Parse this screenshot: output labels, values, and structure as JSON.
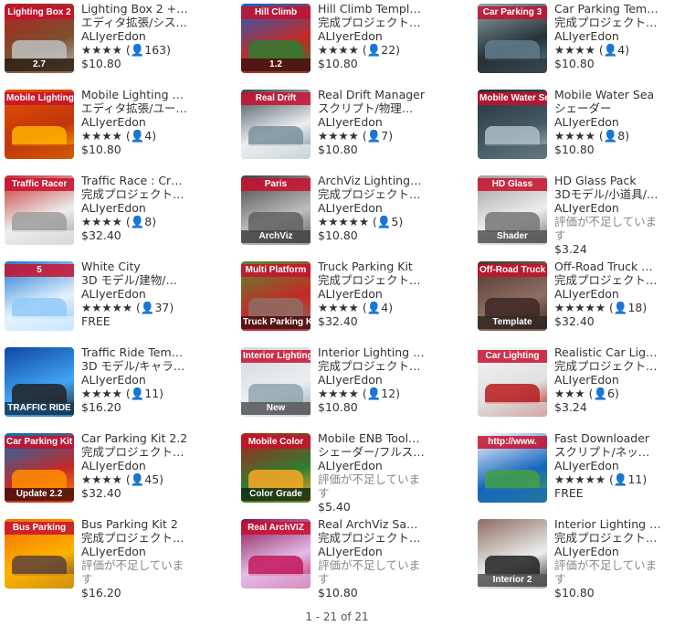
{
  "items": [
    {
      "name": "Lighting Box 2 +…",
      "category": "エディタ拡張/シス…",
      "publisher": "ALIyerEdon",
      "stars": "★★★★",
      "count": "(👤163)",
      "no_rating": "",
      "price": "$10.80",
      "thumb_title": "Lighting Box 2",
      "thumb_badge": "2.7",
      "colors": [
        "#b71c1c",
        "#7a5230",
        "#c0c0c0"
      ]
    },
    {
      "name": "Hill Climb Templ…",
      "category": "完成プロジェクト…",
      "publisher": "ALIyerEdon",
      "stars": "★★★★",
      "count": "(👤22)",
      "no_rating": "",
      "price": "$10.80",
      "thumb_title": "Hill Climb",
      "thumb_badge": "1.2",
      "colors": [
        "#1565c0",
        "#c62828",
        "#2e7d32"
      ]
    },
    {
      "name": "Car Parking Tem…",
      "category": "完成プロジェクト…",
      "publisher": "ALIyerEdon",
      "stars": "★★★★",
      "count": "(👤4)",
      "no_rating": "",
      "price": "$10.80",
      "thumb_title": "Car Parking 3",
      "thumb_badge": "",
      "colors": [
        "#90a4ae",
        "#263238",
        "#607d8b"
      ]
    },
    {
      "name": "Mobile Lighting …",
      "category": "エディタ拡張/ユー…",
      "publisher": "ALIyerEdon",
      "stars": "★★★★",
      "count": "(👤4)",
      "no_rating": "",
      "price": "$10.80",
      "thumb_title": "Mobile Lighting",
      "thumb_badge": "",
      "colors": [
        "#e65100",
        "#bf360c",
        "#ffb300"
      ]
    },
    {
      "name": "Real Drift Manager",
      "category": "スクリプト/物理…",
      "publisher": "ALIyerEdon",
      "stars": "★★★★",
      "count": "(👤7)",
      "no_rating": "",
      "price": "$10.80",
      "thumb_title": "Real Drift",
      "thumb_badge": "",
      "colors": [
        "#37474f",
        "#eceff1",
        "#78909c"
      ]
    },
    {
      "name": "Mobile Water Sea",
      "category": "シェーダー",
      "publisher": "ALIyerEdon",
      "stars": "★★★★",
      "count": "(👤8)",
      "no_rating": "",
      "price": "$10.80",
      "thumb_title": "Mobile Water Sea",
      "thumb_badge": "",
      "colors": [
        "#263238",
        "#455a64",
        "#b0bec5"
      ]
    },
    {
      "name": "Traffic Race : Cr…",
      "category": "完成プロジェクト…",
      "publisher": "ALIyerEdon",
      "stars": "★★★★",
      "count": "(👤8)",
      "no_rating": "",
      "price": "$32.40",
      "thumb_title": "Traffic Racer",
      "thumb_badge": "",
      "colors": [
        "#c62828",
        "#eeeeee",
        "#9e9e9e"
      ]
    },
    {
      "name": "ArchViz Lighting…",
      "category": "完成プロジェクト…",
      "publisher": "ALIyerEdon",
      "stars": "★★★★★",
      "count": "(👤5)",
      "no_rating": "",
      "price": "$10.80",
      "thumb_title": "Paris",
      "thumb_badge": "ArchViz",
      "colors": [
        "#424242",
        "#bdbdbd",
        "#616161"
      ]
    },
    {
      "name": "HD Glass Pack",
      "category": "3Dモデル/小道具/…",
      "publisher": "ALIyerEdon",
      "stars": "",
      "count": "",
      "no_rating": "評価が不足していま す",
      "price": "$3.24",
      "thumb_title": "HD Glass",
      "thumb_badge": "Shader",
      "colors": [
        "#9e9e9e",
        "#eeeeee",
        "#757575"
      ]
    },
    {
      "name": "White City",
      "category": "3D モデル/建物/…",
      "publisher": "ALIyerEdon",
      "stars": "★★★★★",
      "count": "(👤37)",
      "no_rating": "",
      "price": "FREE",
      "thumb_title": "5",
      "thumb_badge": "",
      "colors": [
        "#1976d2",
        "#e3f2fd",
        "#90caf9"
      ]
    },
    {
      "name": "Truck Parking Kit",
      "category": "完成プロジェクト…",
      "publisher": "ALIyerEdon",
      "stars": "★★★★",
      "count": "(👤4)",
      "no_rating": "",
      "price": "$32.40",
      "thumb_title": "Multi Platform",
      "thumb_badge": "Truck Parking Kit",
      "colors": [
        "#558b2f",
        "#c62828",
        "#8d6e63"
      ]
    },
    {
      "name": "Off-Road Truck …",
      "category": "完成プロジェクト…",
      "publisher": "ALIyerEdon",
      "stars": "★★★★★",
      "count": "(👤18)",
      "no_rating": "",
      "price": "$32.40",
      "thumb_title": "Off-Road Truck",
      "thumb_badge": "Template",
      "colors": [
        "#4e342e",
        "#8d6e63",
        "#3e2723"
      ]
    },
    {
      "name": "Traffic Ride Tem…",
      "category": "3D モデル/キャラ…",
      "publisher": "ALIyerEdon",
      "stars": "★★★★",
      "count": "(👤11)",
      "no_rating": "",
      "price": "$16.20",
      "thumb_title": "",
      "thumb_badge": "TRAFFIC RIDE",
      "colors": [
        "#0d47a1",
        "#42a5f5",
        "#212121"
      ]
    },
    {
      "name": "Interior Lighting …",
      "category": "完成プロジェクト…",
      "publisher": "ALIyerEdon",
      "stars": "★★★★",
      "count": "(👤12)",
      "no_rating": "",
      "price": "$10.80",
      "thumb_title": "Interior Lighting",
      "thumb_badge": "New",
      "colors": [
        "#cfd8dc",
        "#eceff1",
        "#90a4ae"
      ]
    },
    {
      "name": "Realistic Car Lig…",
      "category": "完成プロジェクト…",
      "publisher": "ALIyerEdon",
      "stars": "★★★",
      "count": "(👤6)",
      "no_rating": "",
      "price": "$3.24",
      "thumb_title": "Car Lighting",
      "thumb_badge": "",
      "colors": [
        "#f5f5f5",
        "#e0e0e0",
        "#b71c1c"
      ]
    },
    {
      "name": "Car Parking Kit 2.2",
      "category": "完成プロジェクト…",
      "publisher": "ALIyerEdon",
      "stars": "★★★★",
      "count": "(👤45)",
      "no_rating": "",
      "price": "$32.40",
      "thumb_title": "Car Parking Kit",
      "thumb_badge": "Update 2.2",
      "colors": [
        "#0277bd",
        "#c62828",
        "#ff8f00"
      ]
    },
    {
      "name": "Mobile ENB Tool…",
      "category": "シェーダー/フルス…",
      "publisher": "ALIyerEdon",
      "stars": "",
      "count": "",
      "no_rating": "評価が不足していま す",
      "price": "$5.40",
      "thumb_title": "Mobile Color",
      "thumb_badge": "Color Grade",
      "colors": [
        "#b71c1c",
        "#2e7d32",
        "#f9a825"
      ]
    },
    {
      "name": "Fast Downloader",
      "category": "スクリプト/ネッ…",
      "publisher": "ALIyerEdon",
      "stars": "★★★★★",
      "count": "(👤11)",
      "no_rating": "",
      "price": "FREE",
      "thumb_title": "http://www.",
      "thumb_badge": "",
      "colors": [
        "#ffffff",
        "#1565c0",
        "#43a047"
      ]
    },
    {
      "name": "Bus Parking Kit 2",
      "category": "完成プロジェクト…",
      "publisher": "ALIyerEdon",
      "stars": "",
      "count": "",
      "no_rating": "評価が不足していま す",
      "price": "$16.20",
      "thumb_title": "Bus Parking",
      "thumb_badge": "",
      "colors": [
        "#ef6c00",
        "#ffb300",
        "#5d4037"
      ]
    },
    {
      "name": "Real ArchViz Sa…",
      "category": "完成プロジェクト…",
      "publisher": "ALIyerEdon",
      "stars": "",
      "count": "",
      "no_rating": "評価が不足していま す",
      "price": "$10.80",
      "thumb_title": "Real ArchVIZ",
      "thumb_badge": "",
      "colors": [
        "#880e4f",
        "#e1bee7",
        "#c2185b"
      ]
    },
    {
      "name": "Interior Lighting …",
      "category": "完成プロジェクト…",
      "publisher": "ALIyerEdon",
      "stars": "",
      "count": "",
      "no_rating": "評価が不足していま す",
      "price": "$10.80",
      "thumb_title": "",
      "thumb_badge": "Interior 2",
      "colors": [
        "#8d6e63",
        "#eeeeee",
        "#212121"
      ]
    }
  ],
  "pager": {
    "label": "1 - 21 of 21"
  }
}
